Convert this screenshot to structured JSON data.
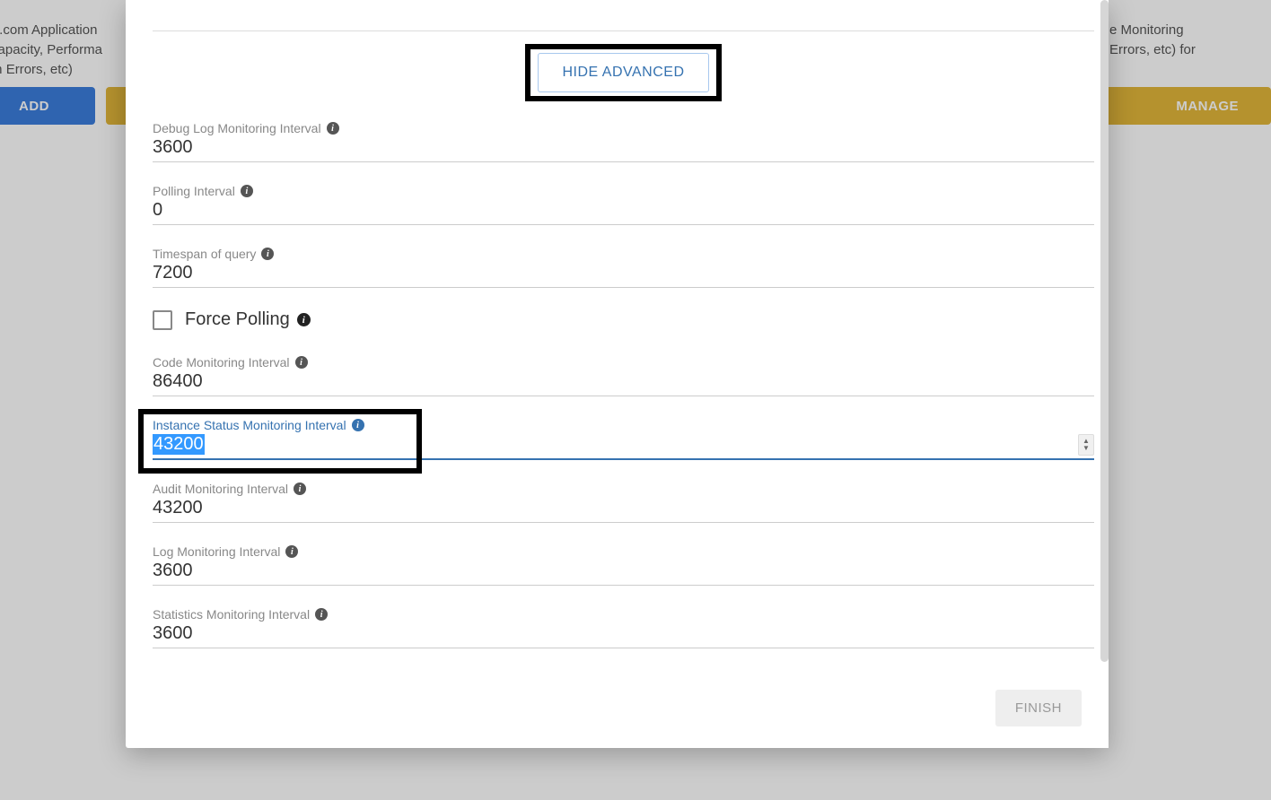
{
  "background": {
    "left_text_lines": [
      "orce.com Application",
      "e, Capacity, Performa",
      "ation Errors, etc)"
    ],
    "right_text_lines": [
      "e Monitoring",
      "Errors, etc) for"
    ],
    "add_button": "ADD",
    "manage_button": "MANAGE"
  },
  "modal": {
    "hide_advanced_label": "HIDE ADVANCED",
    "fields": {
      "debug_log": {
        "label": "Debug Log Monitoring Interval",
        "value": "3600"
      },
      "polling": {
        "label": "Polling Interval",
        "value": "0"
      },
      "timespan": {
        "label": "Timespan of query",
        "value": "7200"
      },
      "force_polling_label": "Force Polling",
      "code": {
        "label": "Code Monitoring Interval",
        "value": "86400"
      },
      "instance": {
        "label": "Instance Status Monitoring Interval",
        "value": "43200"
      },
      "audit": {
        "label": "Audit Monitoring Interval",
        "value": "43200"
      },
      "log": {
        "label": "Log Monitoring Interval",
        "value": "3600"
      },
      "statistics": {
        "label": "Statistics Monitoring Interval",
        "value": "3600"
      }
    },
    "finish_label": "FINISH"
  }
}
